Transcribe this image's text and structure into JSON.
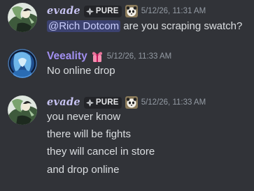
{
  "messages": [
    {
      "author": "evade",
      "tag": "PURE",
      "timestamp": "5/12/26, 11:31 AM",
      "mention": "@Rich Dotcom",
      "text": " are you scraping swatch?",
      "avatar_icon": "anime-character-avatar",
      "tag_icon": "clover-icon",
      "role_icon": "panda-icon"
    },
    {
      "author": "Veeality",
      "timestamp": "5/12/26, 11:33 AM",
      "text": "No online drop",
      "avatar_icon": "blue-character-avatar",
      "role_icon": "gift-ribbon-icon"
    },
    {
      "author": "evade",
      "tag": "PURE",
      "timestamp": "5/12/26, 11:33 AM",
      "lines": [
        "you never know",
        "there will be fights",
        "they will cancel in store",
        "and drop online"
      ],
      "avatar_icon": "anime-character-avatar",
      "tag_icon": "clover-icon",
      "role_icon": "panda-icon"
    }
  ],
  "colors": {
    "background": "#313338",
    "evade_name": "#c7c3f2",
    "veeality_name": "#a18ff0",
    "timestamp": "#949ba4",
    "text": "#dbdee1",
    "mention_bg": "#3c4270",
    "mention_text": "#c9cdfb"
  }
}
